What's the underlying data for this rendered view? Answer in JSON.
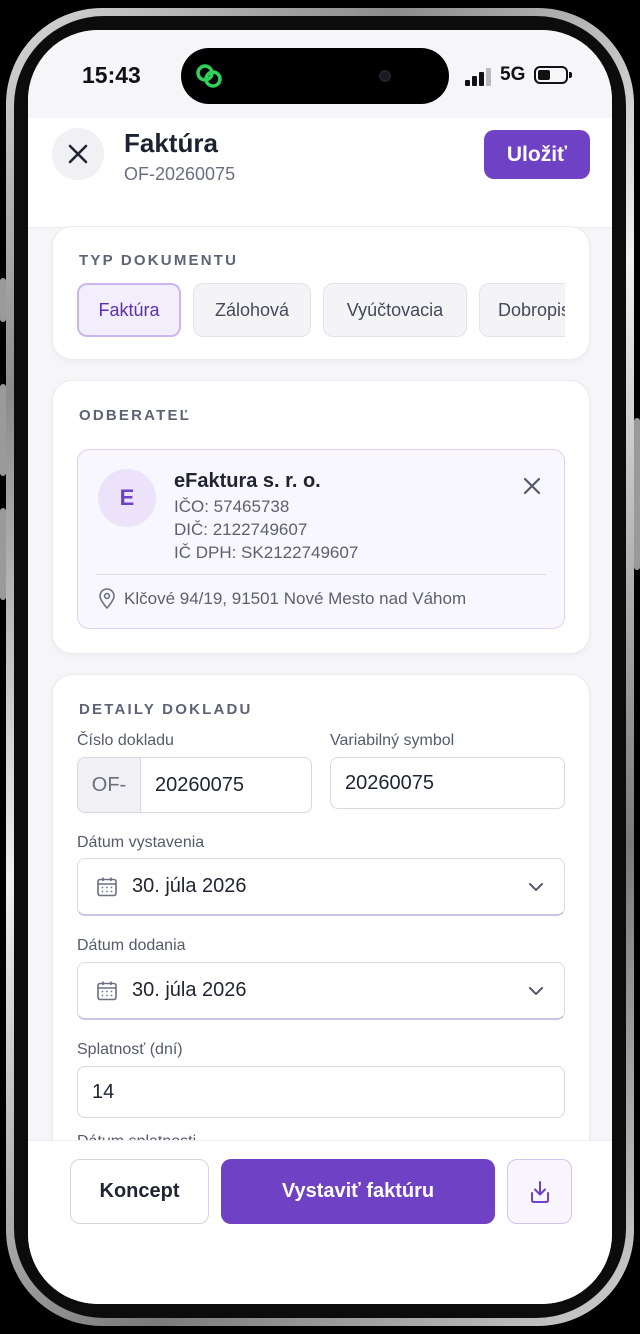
{
  "status_bar": {
    "time": "15:43",
    "network": "5G",
    "battery_level": 0.35
  },
  "header": {
    "title": "Faktúra",
    "doc_number": "OF-20260075",
    "save_label": "Uložiť"
  },
  "doc_type": {
    "label": "TYP DOKUMENTU",
    "options": [
      {
        "label": "Faktúra",
        "selected": true
      },
      {
        "label": "Zálohová",
        "selected": false
      },
      {
        "label": "Vyúčtovacia",
        "selected": false
      },
      {
        "label": "Dobropis",
        "selected": false
      }
    ]
  },
  "customer": {
    "label": "ODBERATEĽ",
    "initial": "E",
    "name": "eFaktura s. r. o.",
    "ico": "IČO: 57465738",
    "dic": "DIČ: 2122749607",
    "ic_dph": "IČ DPH: SK2122749607",
    "address": "Klčové 94/19, 91501 Nové Mesto nad Váhom"
  },
  "details": {
    "label": "DETAILY DOKLADU",
    "number_label": "Číslo dokladu",
    "number_prefix": "OF-",
    "number_value": "20260075",
    "variable_symbol_label": "Variabilný symbol",
    "variable_symbol_value": "20260075",
    "issue_date_label": "Dátum vystavenia",
    "issue_date_value": "30. júla 2026",
    "delivery_date_label": "Dátum dodania",
    "delivery_date_value": "30. júla 2026",
    "due_days_label": "Splatnosť (dní)",
    "due_days_value": "14",
    "due_date_label": "Dátum splatnosti"
  },
  "actions": {
    "draft_label": "Koncept",
    "issue_label": "Vystaviť faktúru"
  },
  "colors": {
    "accent": "#6f41c4",
    "accent_light": "#f3eefc",
    "background": "#f6f6f9"
  }
}
